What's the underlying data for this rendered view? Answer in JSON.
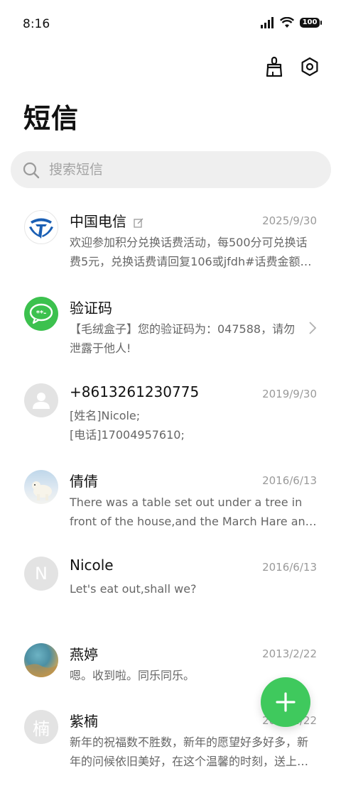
{
  "status_bar": {
    "time": "8:16",
    "battery": "100"
  },
  "header": {
    "title": "短信"
  },
  "search": {
    "placeholder": "搜索短信"
  },
  "messages": [
    {
      "name": "中国电信",
      "date": "2025/9/30",
      "preview": "欢迎参加积分兑换话费活动，每500分可兑换话费5元，兑换话费请回复106或jfdh#话费金额…",
      "avatar": "china-telecom-logo"
    },
    {
      "name": "验证码",
      "date": "",
      "preview": "【毛绒盒子】您的验证码为：047588，请勿泄露于他人!",
      "avatar": "verification-code-icon"
    },
    {
      "name": "+8613261230775",
      "date": "2019/9/30",
      "preview": "[姓名]Nicole;\n[电话]17004957610;",
      "avatar": "person-icon"
    },
    {
      "name": "倩倩",
      "date": "2016/6/13",
      "preview": "There was a table set out under a tree in front of the house,and the March Hare and the Hatter were having tea",
      "avatar": "polar-bear-photo"
    },
    {
      "name": "Nicole",
      "date": "2016/6/13",
      "preview": "Let's eat out,shall we?",
      "avatar_initial": "N"
    },
    {
      "name": "燕婷",
      "date": "2013/2/22",
      "preview": "嗯。收到啦。同乐同乐。",
      "avatar": "landscape-photo"
    },
    {
      "name": "紫楠",
      "date": "2013/2/22",
      "preview": "新年的祝福数不胜数，新年的愿望好多好多，新年的问候依旧美好，在这个温馨的时刻，送上我的祝福",
      "avatar_initial": "楠"
    }
  ],
  "colors": {
    "accent": "#3fc95d",
    "telecom_blue": "#1a5fb4",
    "avatar_gray": "#e3e3e3"
  }
}
